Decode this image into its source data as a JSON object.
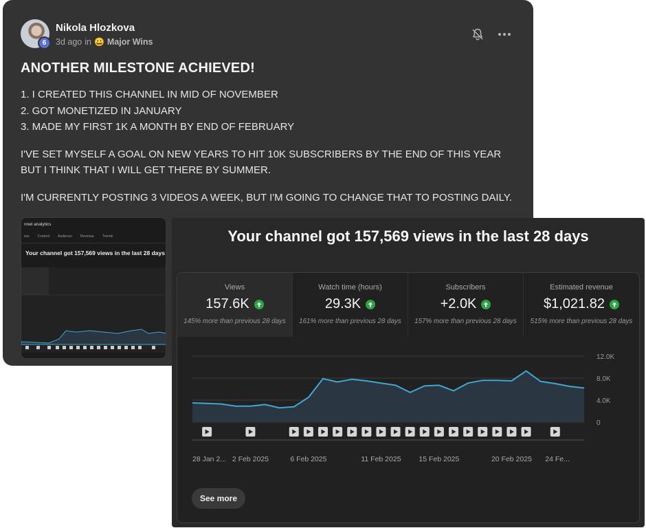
{
  "post": {
    "author": "Nikola Hlozkova",
    "level_badge": "6",
    "time": "3d ago",
    "in_word": "in",
    "category_emoji": "😀",
    "category": "Major Wins",
    "title": "ANOTHER MILESTONE ACHIEVED!",
    "lines": [
      "1. I CREATED THIS CHANNEL IN MID OF NOVEMBER",
      "2. GOT MONETIZED IN JANUARY",
      "3. MADE MY FIRST 1K A MONTH BY END OF FEBRUARY"
    ],
    "paragraphs": [
      "I'VE SET MYSELF A GOAL ON NEW YEARS TO HIT 10K SUBSCRIBERS BY THE END OF THIS YEAR BUT I THINK THAT I WILL GET THERE BY SUMMER.",
      "I'M CURRENTLY POSTING 3 VIDEOS A WEEK, BUT I'M GOING TO CHANGE THAT TO POSTING DAILY."
    ],
    "icons": {
      "bell": "bell-off-icon",
      "more": "more-horizontal-icon"
    }
  },
  "thumbnail": {
    "title": "nnel analytics",
    "tabs": [
      "iew",
      "Content",
      "Audience",
      "Revenue",
      "Trends"
    ],
    "headline": "Your channel got 157,569 views in the last 28 days"
  },
  "analytics": {
    "headline": "Your channel got 157,569 views in the last 28 days",
    "metrics": [
      {
        "label": "Views",
        "value": "157.6K",
        "note": "145% more than previous 28 days"
      },
      {
        "label": "Watch time (hours)",
        "value": "29.3K",
        "note": "161% more than previous 28 days"
      },
      {
        "label": "Subscribers",
        "value": "+2.0K",
        "note": "157% more than previous 28 days"
      },
      {
        "label": "Estimated revenue",
        "value": "$1,021.82",
        "note": "515% more than previous 28 days"
      }
    ],
    "see_more": "See more",
    "colors": {
      "line": "#41a6d4",
      "area": "#2a3742",
      "up_arrow": "#2ba640"
    }
  },
  "chart_data": {
    "type": "area",
    "y_ticks": [
      "12.0K",
      "8.0K",
      "4.0K",
      "0"
    ],
    "ylim": [
      0,
      12000
    ],
    "x_labels": [
      "28 Jan 2...",
      "2 Feb 2025",
      "6 Feb 2025",
      "11 Feb 2025",
      "15 Feb 2025",
      "20 Feb 2025",
      "24 Fe..."
    ],
    "x_label_index": [
      0,
      4,
      8,
      13,
      17,
      22,
      26
    ],
    "values": [
      3500,
      3400,
      3300,
      2900,
      2900,
      3200,
      2600,
      2800,
      4500,
      7900,
      7300,
      7800,
      7500,
      7100,
      6700,
      5400,
      6600,
      6700,
      5700,
      7100,
      7600,
      7600,
      7500,
      9300,
      7400,
      7000,
      6500,
      6200
    ],
    "marker_index": [
      1,
      4,
      7,
      8,
      9,
      10,
      11,
      12,
      13,
      14,
      15,
      16,
      17,
      18,
      19,
      20,
      21,
      22,
      23,
      25
    ],
    "grid": true
  }
}
